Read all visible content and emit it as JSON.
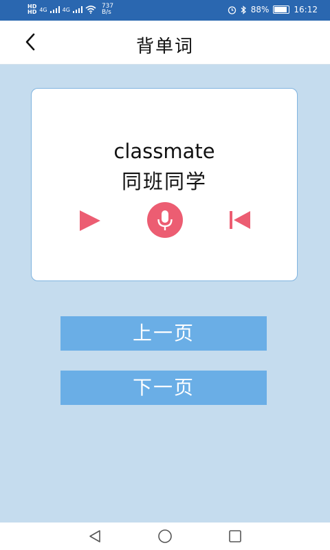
{
  "status_bar": {
    "hd_top": "HD",
    "hd_bottom": "HD",
    "signal_1": "4G",
    "signal_2": "4G",
    "net_speed_value": "737",
    "net_speed_unit": "B/s",
    "battery": "88%",
    "battery_level": 0.88,
    "time": "16:12",
    "icons": [
      "alarm-icon",
      "bluetooth-icon",
      "wifi-icon",
      "signal-icon",
      "battery-icon"
    ]
  },
  "header": {
    "title": "背单词",
    "back_icon": "chevron-left-icon"
  },
  "card": {
    "word": "classmate",
    "meaning": "同班同学",
    "controls": [
      "play-icon",
      "microphone-icon",
      "skip-previous-icon"
    ],
    "accent_color": "#ec5d72"
  },
  "buttons": {
    "prev_label": "上一页",
    "next_label": "下一页"
  },
  "nav_bar": {
    "icons": [
      "back-triangle-icon",
      "home-circle-icon",
      "recents-square-icon"
    ]
  },
  "colors": {
    "status_bar": "#2a67b0",
    "background": "#c5dcee",
    "button": "#6aaee6",
    "card_border": "#7fb3df"
  }
}
